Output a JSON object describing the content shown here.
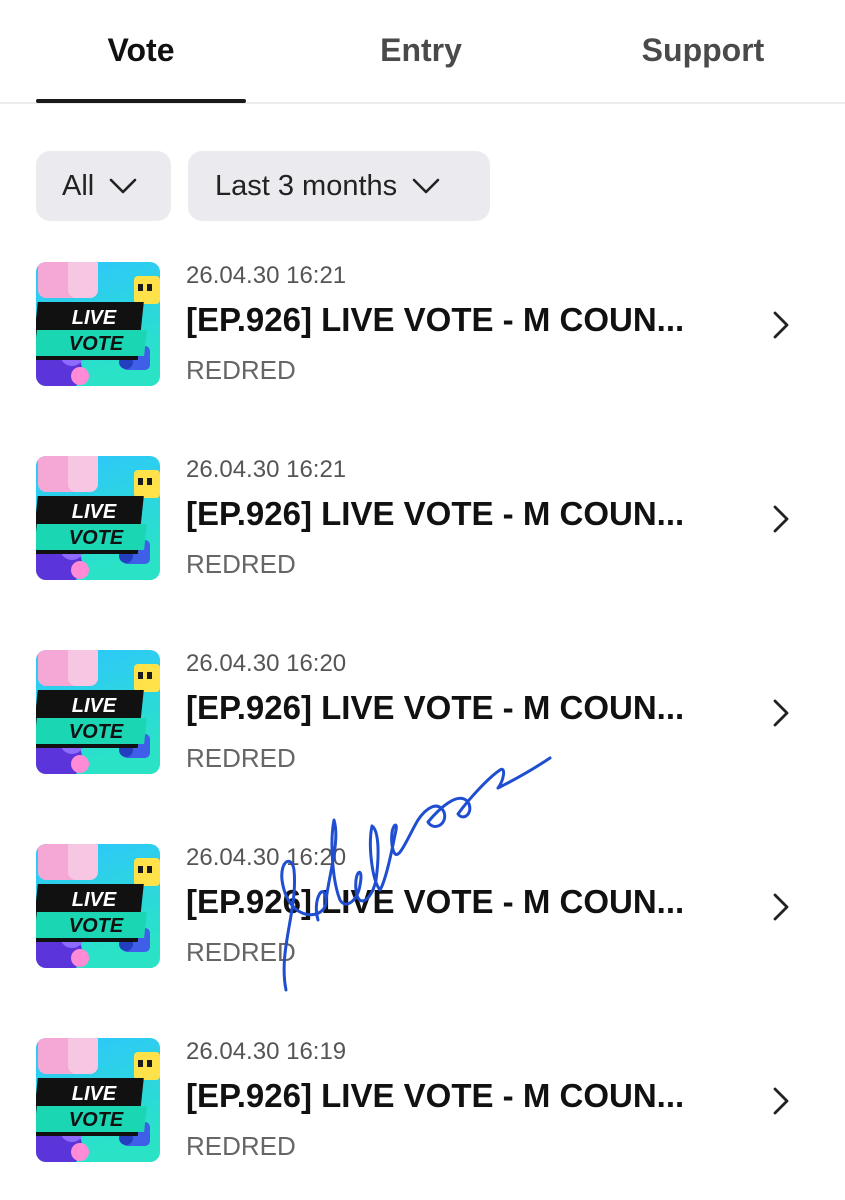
{
  "tabs": [
    {
      "label": "Vote",
      "active": true
    },
    {
      "label": "Entry",
      "active": false
    },
    {
      "label": "Support",
      "active": false
    }
  ],
  "filters": {
    "category": "All",
    "period": "Last 3 months"
  },
  "thumbnail": {
    "line1": "LIVE",
    "line2": "VOTE"
  },
  "items": [
    {
      "date": "26.04.30 16:21",
      "title": "[EP.926] LIVE VOTE - M COUN...",
      "artist": "REDRED"
    },
    {
      "date": "26.04.30 16:21",
      "title": "[EP.926] LIVE VOTE - M COUN...",
      "artist": "REDRED"
    },
    {
      "date": "26.04.30 16:20",
      "title": "[EP.926] LIVE VOTE - M COUN...",
      "artist": "REDRED"
    },
    {
      "date": "26.04.30 16:20",
      "title": "[EP.926] LIVE VOTE - M COUN...",
      "artist": "REDRED"
    },
    {
      "date": "26.04.30 16:19",
      "title": "[EP.926] LIVE VOTE - M COUN...",
      "artist": "REDRED"
    }
  ],
  "colors": {
    "signature": "#1f4fd0",
    "thumb_bg_top": "#2ec5ff",
    "thumb_bg_bottom": "#27e0c8"
  }
}
